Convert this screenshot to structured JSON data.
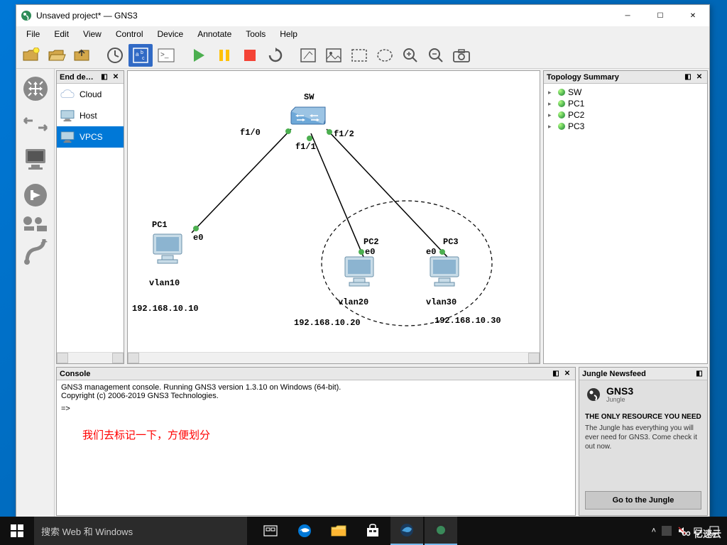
{
  "window": {
    "title": "Unsaved project* — GNS3"
  },
  "menu": {
    "file": "File",
    "edit": "Edit",
    "view": "View",
    "control": "Control",
    "device": "Device",
    "annotate": "Annotate",
    "tools": "Tools",
    "help": "Help"
  },
  "devices_panel": {
    "title": "End de…",
    "items": [
      {
        "label": "Cloud"
      },
      {
        "label": "Host"
      },
      {
        "label": "VPCS"
      }
    ]
  },
  "canvas": {
    "sw": {
      "label": "SW"
    },
    "ports": {
      "f10": "f1/0",
      "f11": "f1/1",
      "f12": "f1/2"
    },
    "pc1": {
      "name": "PC1",
      "iface": "e0",
      "vlan": "vlan10",
      "ip": "192.168.10.10"
    },
    "pc2": {
      "name": "PC2",
      "iface": "e0",
      "vlan": "vlan20",
      "ip": "192.168.10.20"
    },
    "pc3": {
      "name": "PC3",
      "iface": "e0",
      "vlan": "vlan30",
      "ip": "192.168.10.30"
    }
  },
  "topology": {
    "title": "Topology Summary",
    "items": [
      {
        "label": "SW"
      },
      {
        "label": "PC1"
      },
      {
        "label": "PC2"
      },
      {
        "label": "PC3"
      }
    ]
  },
  "console": {
    "title": "Console",
    "line1": "GNS3 management console. Running GNS3 version 1.3.10 on Windows (64-bit).",
    "line2": "Copyright (c) 2006-2019 GNS3 Technologies.",
    "prompt": "=>",
    "annotation": "我们去标记一下，方便划分"
  },
  "newsfeed": {
    "title": "Jungle Newsfeed",
    "logo": "GNS3",
    "logo_sub": "Jungle",
    "headline": "THE ONLY RESOURCE YOU NEED",
    "body": "The Jungle has everything you will ever need for GNS3. Come check it out now.",
    "button": "Go to the Jungle"
  },
  "taskbar": {
    "search_placeholder": "搜索 Web 和 Windows"
  },
  "watermark": "亿速云"
}
